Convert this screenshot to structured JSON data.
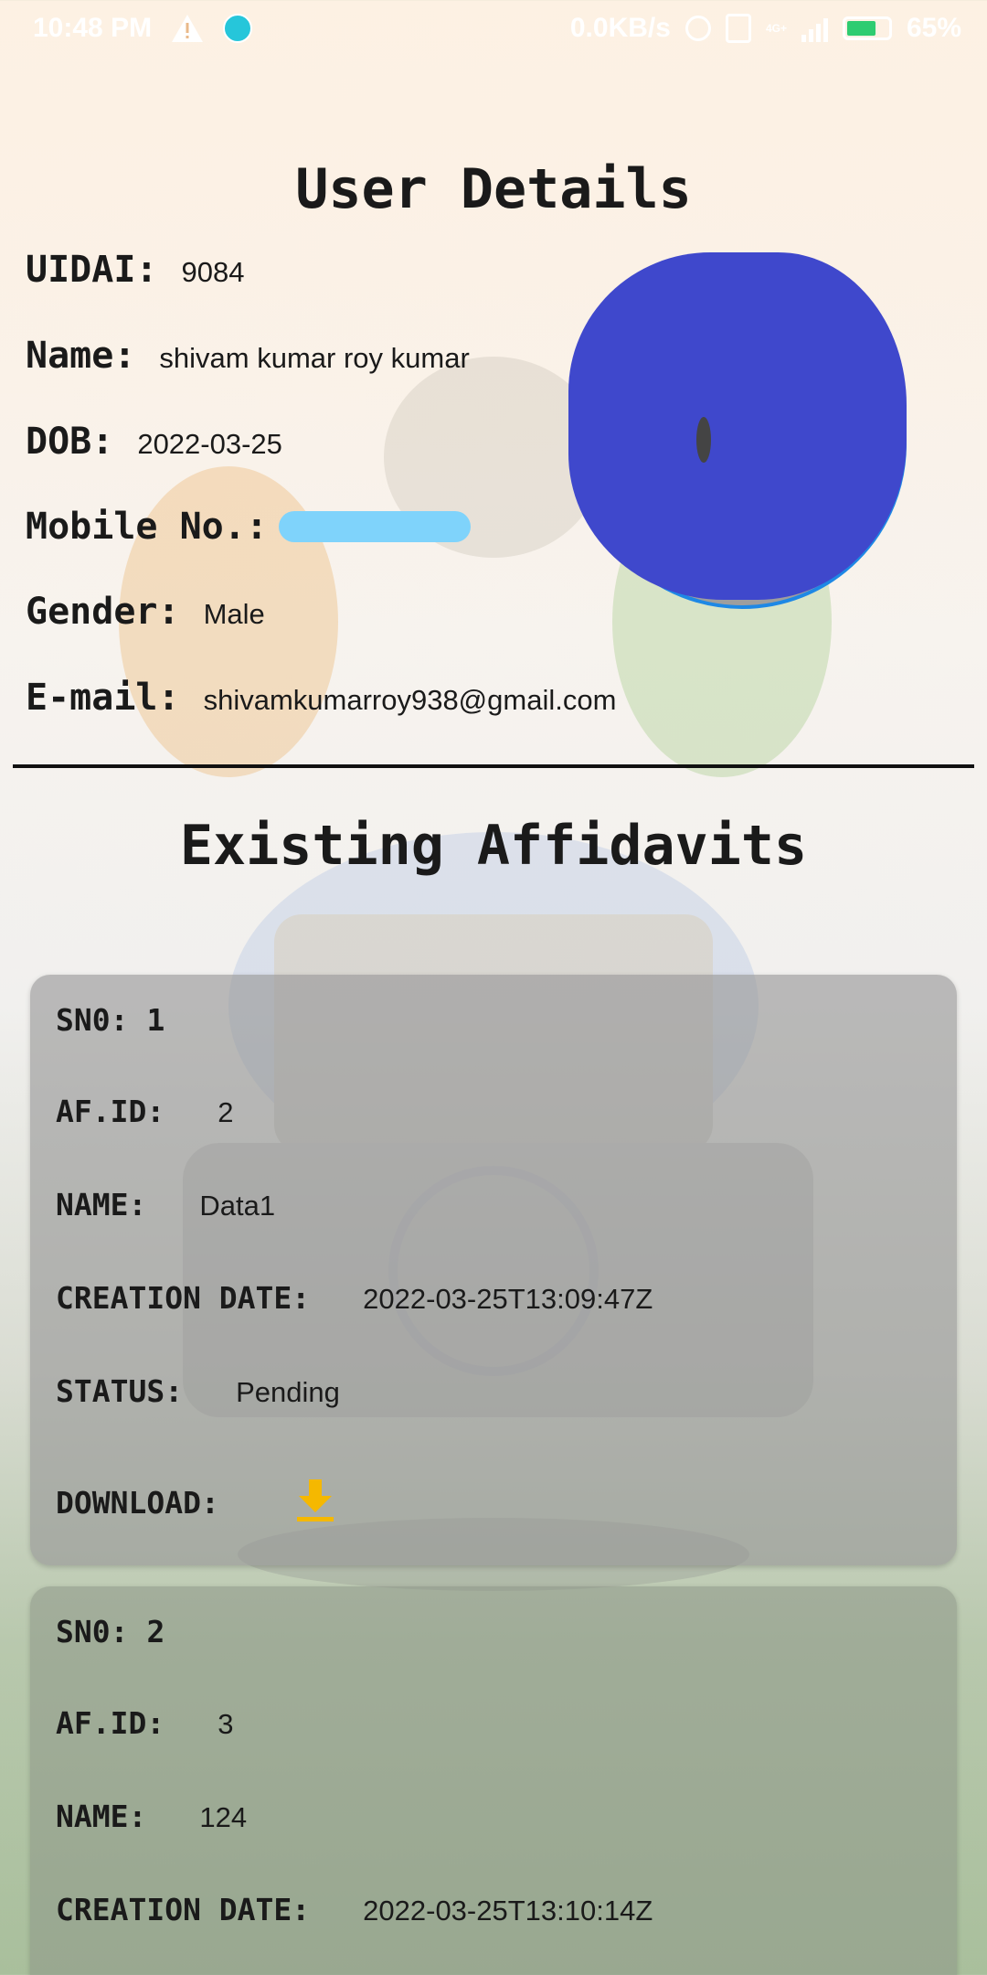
{
  "status_bar": {
    "time": "10:48 PM",
    "network_speed": "0.0KB/s",
    "network_type": "4G+",
    "battery": "65%",
    "icons": [
      "warning-icon",
      "aperture-icon",
      "alarm-icon",
      "sim-icon",
      "signal-icon",
      "battery-icon"
    ]
  },
  "user_details": {
    "title": "User Details",
    "uidai_label": "UIDAI:",
    "uidai_value": "9084",
    "name_label": "Name:",
    "name_value": "shivam kumar roy kumar",
    "dob_label": "DOB:",
    "dob_value": "2022-03-25",
    "mobile_label": "Mobile No.:",
    "mobile_value": "",
    "gender_label": "Gender:",
    "gender_value": "Male",
    "email_label": "E-mail:",
    "email_value": "shivamkumarroy938@gmail.com"
  },
  "affidavits": {
    "title": "Existing Affidavits",
    "labels": {
      "sno": "SN0:",
      "af_id": "AF.ID:",
      "name": "NAME:",
      "creation_date": "CREATION DATE:",
      "status": "STATUS:",
      "download": "DOWNLOAD:"
    },
    "items": [
      {
        "sno": "1",
        "af_id": "2",
        "name": "Data1",
        "creation_date": "2022-03-25T13:09:47Z",
        "status": "Pending",
        "download_icon": "download-icon"
      },
      {
        "sno": "2",
        "af_id": "3",
        "name": "124",
        "creation_date": "2022-03-25T13:10:14Z"
      }
    ]
  },
  "colors": {
    "download_icon": "#f5b800",
    "avatar_border": "#1e88e5",
    "redaction_blue": "#3f48cc",
    "redaction_light": "#7fd3fb"
  }
}
